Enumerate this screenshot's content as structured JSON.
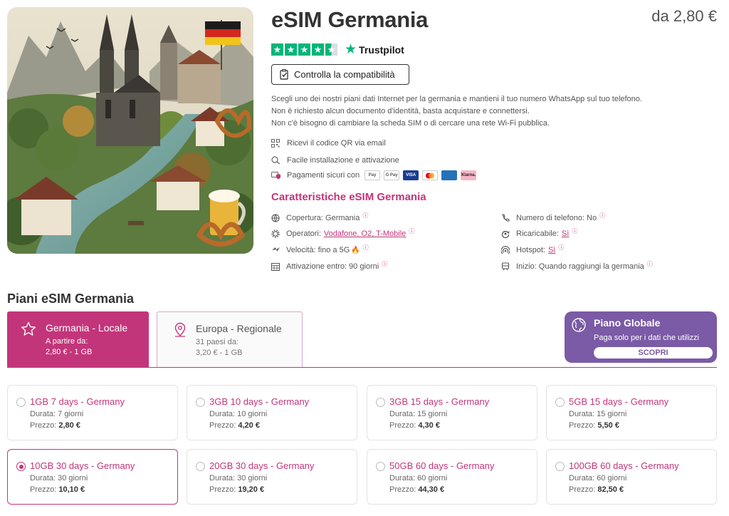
{
  "product": {
    "title": "eSIM Germania",
    "price_from": "da 2,80 €",
    "rating_fraction": 0.9,
    "trustpilot_label": "Trustpilot",
    "compat_button": "Controlla la compatibilità",
    "description": [
      "Scegli uno dei nostri piani dati Internet per la germania e mantieni il tuo numero WhatsApp sul tuo telefono.",
      "Non è richiesto alcun documento d'identità, basta acquistare e connettersi.",
      "Non c'è bisogno di cambiare la scheda SIM o di cercare una rete Wi-Fi pubblica."
    ],
    "features": {
      "qr": "Ricevi il codice QR via email",
      "install": "Facile installazione e attivazione",
      "payments": "Pagamenti sicuri con",
      "pay_methods": [
        "Pay",
        "G Pay",
        "VISA",
        "",
        "",
        "Klarna."
      ]
    }
  },
  "specs": {
    "title": "Caratteristiche eSIM Germania",
    "coverage": "Copertura: Germania",
    "operators_label": "Operatori:",
    "operators_value": "Vodafone, O2, T-Mobile",
    "speed": "Velocità: fino a 5G",
    "activation": "Attivazione entro: 90 giorni",
    "phone": "Numero di telefono: No",
    "rechargeable_label": "Ricaricabile:",
    "rechargeable_value": "Sì",
    "hotspot_label": "Hotspot:",
    "hotspot_value": "Sì",
    "start": "Inizio: Quando raggiungi la germania",
    "info_mark": "ⓘ"
  },
  "plans": {
    "title": "Piani eSIM Germania",
    "tabs": [
      {
        "name": "Germania - Locale",
        "sub1": "A partire da:",
        "sub2": "2,80 € - 1 GB"
      },
      {
        "name": "Europa - Regionale",
        "sub1": "31 paesi da:",
        "sub2": "3,20 € - 1 GB"
      }
    ],
    "global": {
      "title": "Piano Globale",
      "sub": "Paga solo per i dati che utilizzi",
      "button": "SCOPRI"
    },
    "duration_label": "Durata:",
    "price_label": "Prezzo:",
    "cards": [
      {
        "name": "1GB 7 days - Germany",
        "duration": "7 giorni",
        "price": "2,80 €"
      },
      {
        "name": "3GB 10 days - Germany",
        "duration": "10 giorni",
        "price": "4,20 €"
      },
      {
        "name": "3GB 15 days - Germany",
        "duration": "15 giorni",
        "price": "4,30 €"
      },
      {
        "name": "5GB 15 days - Germany",
        "duration": "15 giorni",
        "price": "5,50 €"
      },
      {
        "name": "10GB 30 days - Germany",
        "duration": "30 giorni",
        "price": "10,10 €",
        "selected": true
      },
      {
        "name": "20GB 30 days - Germany",
        "duration": "30 giorni",
        "price": "19,20 €"
      },
      {
        "name": "50GB 60 days - Germany",
        "duration": "60 giorni",
        "price": "44,30 €"
      },
      {
        "name": "100GB 60 days - Germany",
        "duration": "60 giorni",
        "price": "82,50 €"
      }
    ]
  },
  "colors": {
    "accent": "#c2357a",
    "global": "#7b5aa6",
    "trustpilot": "#00b67a"
  }
}
